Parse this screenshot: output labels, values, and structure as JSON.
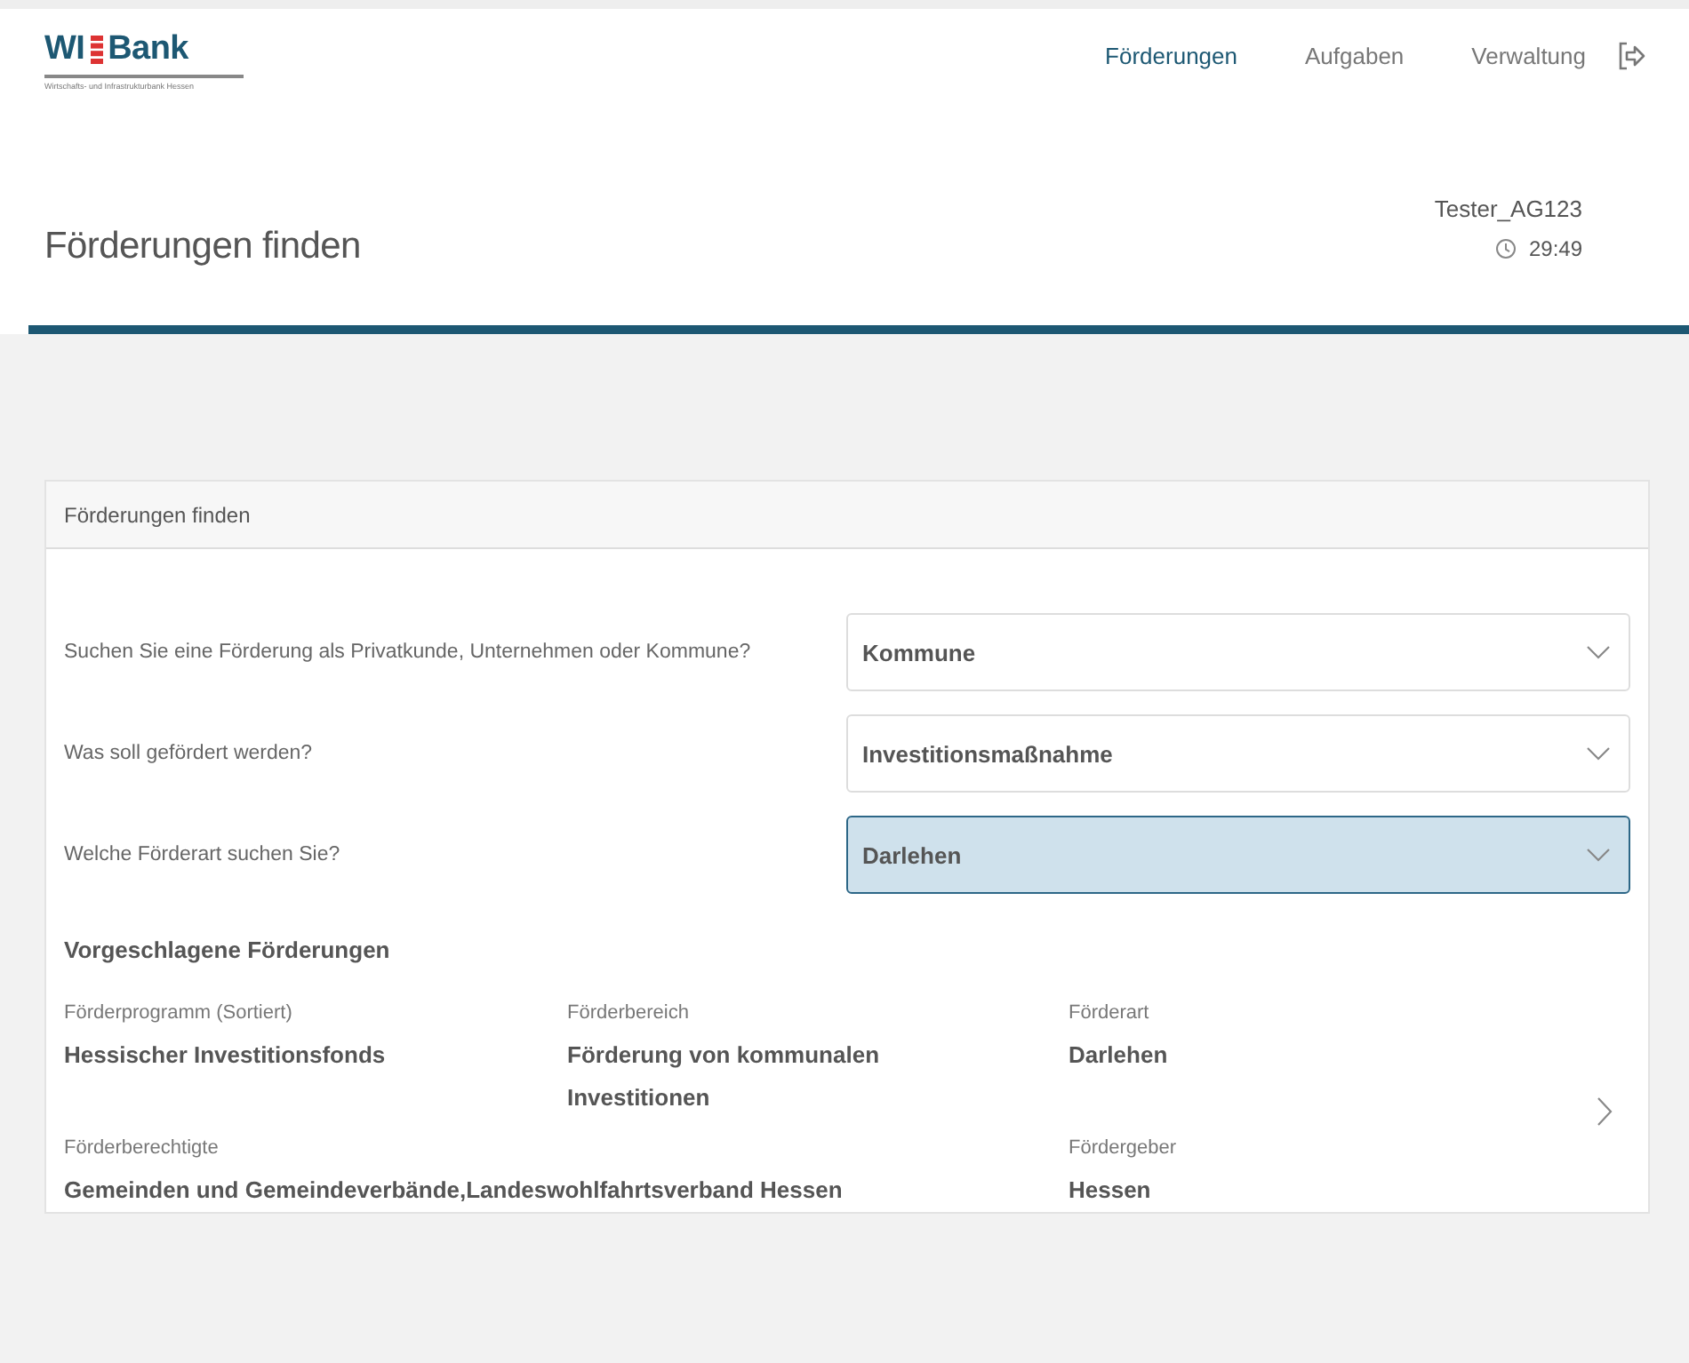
{
  "logo": {
    "name": "WI",
    "name_2": "Bank",
    "subtitle": "Wirtschafts- und Infrastrukturbank Hessen"
  },
  "nav": [
    {
      "label": "Förderungen",
      "selected": true
    },
    {
      "label": "Aufgaben",
      "selected": false
    },
    {
      "label": "Verwaltung",
      "selected": false
    }
  ],
  "page_title": "Förderungen finden",
  "user": {
    "name": "Tester_AG123",
    "timer": "29:49"
  },
  "card": {
    "title": "Förderungen finden",
    "questions": [
      {
        "label": "Suchen Sie eine Förderung als Privatkunde, Unternehmen oder Kommune?",
        "value": "Kommune",
        "selected": false
      },
      {
        "label": "Was soll gefördert werden?",
        "value": "Investitionsmaßnahme",
        "selected": false
      },
      {
        "label": "Welche Förderart suchen Sie?",
        "value": "Darlehen",
        "selected": true
      }
    ],
    "suggestions_title": "Vorgeschlagene Förderungen",
    "suggestion": {
      "fields": [
        {
          "label": "Förderprogramm (Sortiert)",
          "value": "Hessischer Investitionsfonds"
        },
        {
          "label": "Förderbereich",
          "value": "Förderung von kommunalen Investitionen"
        },
        {
          "label": "Förderart",
          "value": "Darlehen"
        },
        {
          "label": "Förderberechtigte",
          "value": "Gemeinden und Gemeindeverbände,Landeswohlfahrtsverband Hessen"
        },
        {
          "label": "Fördergeber",
          "value": "Hessen"
        }
      ]
    }
  }
}
